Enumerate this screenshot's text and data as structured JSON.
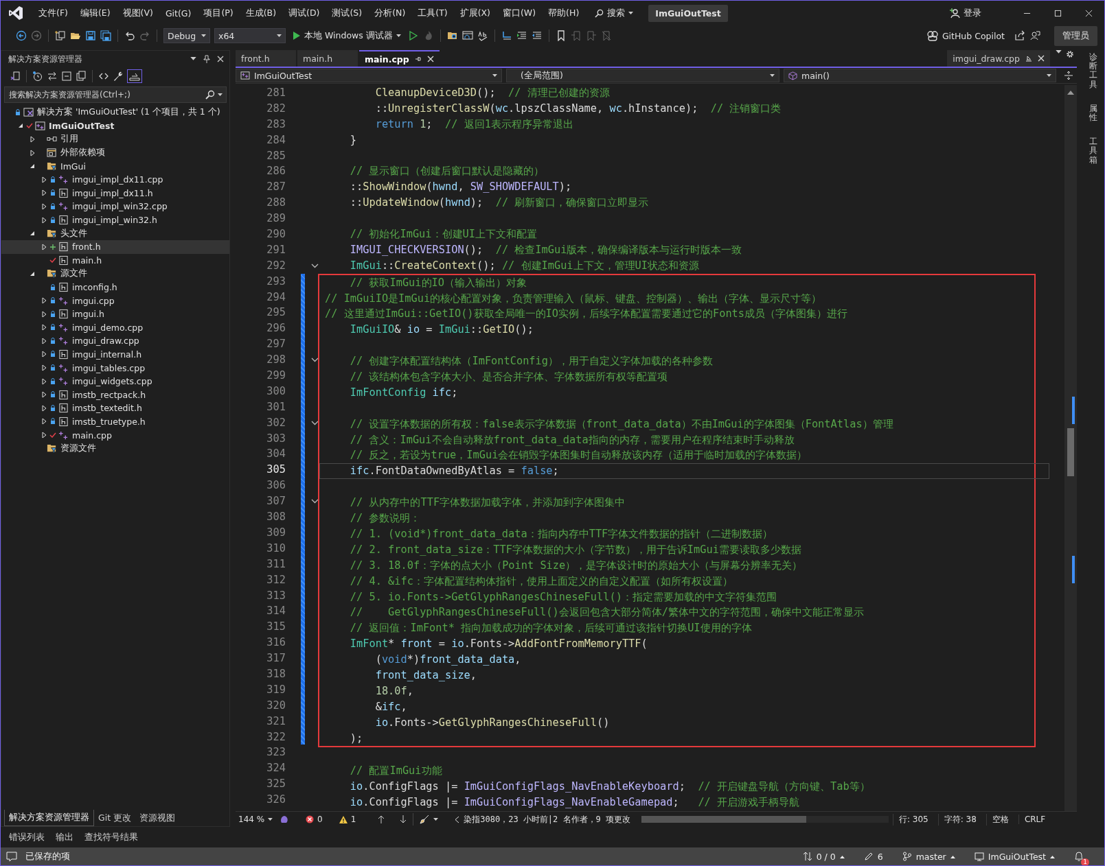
{
  "title_bar": {
    "menus": [
      "文件(F)",
      "编辑(E)",
      "视图(V)",
      "Git(G)",
      "项目(P)",
      "生成(B)",
      "调试(D)",
      "测试(S)",
      "分析(N)",
      "工具(T)",
      "扩展(X)",
      "窗口(W)",
      "帮助(H)"
    ],
    "search": "搜索",
    "title": "ImGuiOutTest",
    "sign_in": "登录"
  },
  "toolbar": {
    "configuration": "Debug",
    "platform": "x64",
    "run": "本地 Windows 调试器",
    "copilot": "GitHub Copilot",
    "admin": "管理员"
  },
  "solution_explorer": {
    "title": "解决方案资源管理器",
    "search": {
      "placeholder": "搜索解决方案资源管理器(Ctrl+;)"
    },
    "tree": [
      {
        "label": "解决方案 'ImGuiOutTest' (1 个项目，共 1 个)",
        "kind": "solution",
        "locked": true,
        "selected": false,
        "children": [
          {
            "label": "ImGuiOutTest",
            "kind": "project",
            "modified": true,
            "expanded": true,
            "selected": false,
            "children": [
              {
                "label": "引用",
                "kind": "references",
                "expanded": false,
                "selected": false
              },
              {
                "label": "外部依赖项",
                "kind": "dependencies",
                "expanded": false,
                "selected": false
              },
              {
                "label": "ImGui",
                "kind": "filter",
                "expanded": true,
                "selected": false,
                "children": [
                  {
                    "label": "imgui_impl_dx11.cpp",
                    "kind": "cpp",
                    "locked": true,
                    "expanded": false,
                    "selected": false
                  },
                  {
                    "label": "imgui_impl_dx11.h",
                    "kind": "header",
                    "locked": true,
                    "expanded": false,
                    "selected": false
                  },
                  {
                    "label": "imgui_impl_win32.cpp",
                    "kind": "cpp",
                    "locked": true,
                    "expanded": false,
                    "selected": false
                  },
                  {
                    "label": "imgui_impl_win32.h",
                    "kind": "header",
                    "locked": true,
                    "expanded": false,
                    "selected": false
                  }
                ]
              },
              {
                "label": "头文件",
                "kind": "filter",
                "expanded": true,
                "selected": false,
                "children": [
                  {
                    "label": "front.h",
                    "kind": "header",
                    "added": true,
                    "expanded": false,
                    "selected": true
                  },
                  {
                    "label": "main.h",
                    "kind": "header",
                    "modified": true,
                    "selected": false
                  }
                ]
              },
              {
                "label": "源文件",
                "kind": "filter",
                "expanded": true,
                "selected": false,
                "children": [
                  {
                    "label": "imconfig.h",
                    "kind": "header",
                    "locked": true,
                    "selected": false
                  },
                  {
                    "label": "imgui.cpp",
                    "kind": "cpp",
                    "locked": true,
                    "expanded": false,
                    "selected": false
                  },
                  {
                    "label": "imgui.h",
                    "kind": "header",
                    "locked": true,
                    "expanded": false,
                    "selected": false
                  },
                  {
                    "label": "imgui_demo.cpp",
                    "kind": "cpp",
                    "locked": true,
                    "expanded": false,
                    "selected": false
                  },
                  {
                    "label": "imgui_draw.cpp",
                    "kind": "cpp",
                    "locked": true,
                    "expanded": false,
                    "selected": false
                  },
                  {
                    "label": "imgui_internal.h",
                    "kind": "header",
                    "locked": true,
                    "expanded": false,
                    "selected": false
                  },
                  {
                    "label": "imgui_tables.cpp",
                    "kind": "cpp",
                    "locked": true,
                    "expanded": false,
                    "selected": false
                  },
                  {
                    "label": "imgui_widgets.cpp",
                    "kind": "cpp",
                    "locked": true,
                    "expanded": false,
                    "selected": false
                  },
                  {
                    "label": "imstb_rectpack.h",
                    "kind": "header",
                    "locked": true,
                    "expanded": false,
                    "selected": false
                  },
                  {
                    "label": "imstb_textedit.h",
                    "kind": "header",
                    "locked": true,
                    "expanded": false,
                    "selected": false
                  },
                  {
                    "label": "imstb_truetype.h",
                    "kind": "header",
                    "locked": true,
                    "expanded": false,
                    "selected": false
                  },
                  {
                    "label": "main.cpp",
                    "kind": "cpp",
                    "modified": true,
                    "expanded": false,
                    "selected": false
                  }
                ]
              },
              {
                "label": "资源文件",
                "kind": "filter",
                "selected": false
              }
            ]
          }
        ]
      }
    ]
  },
  "panel_tabs": [
    {
      "label": "解决方案资源管理器",
      "selected": true
    },
    {
      "label": "Git 更改",
      "selected": false
    },
    {
      "label": "资源视图",
      "selected": false
    }
  ],
  "tool_tabs": [
    "错误列表",
    "输出",
    "查找符号结果"
  ],
  "editor": {
    "tabs": [
      {
        "label": "front.h",
        "selected": false
      },
      {
        "label": "main.h",
        "selected": false
      },
      {
        "label": "main.cpp",
        "selected": true
      }
    ],
    "preview_tab": "imgui_draw.cpp",
    "nav": {
      "project": "ImGuiOutTest",
      "scope": "(全局范围)",
      "member": "main()"
    },
    "sections": [
      {
        "lines": [
          {
            "number": "281",
            "tokens": [
              {
                "text": "        CleanupDeviceD3D",
                "kind": "function"
              },
              {
                "text": "();  ",
                "kind": "plain"
              },
              {
                "text": "// 清理已创建的资源",
                "kind": "comment"
              }
            ]
          },
          {
            "number": "282",
            "tokens": [
              {
                "text": "        ::",
                "kind": "plain"
              },
              {
                "text": "UnregisterClassW",
                "kind": "function"
              },
              {
                "text": "(",
                "kind": "plain"
              },
              {
                "text": "wc",
                "kind": "variable"
              },
              {
                "text": ".lpszClassName, ",
                "kind": "plain"
              },
              {
                "text": "wc",
                "kind": "variable"
              },
              {
                "text": ".hInstance);  ",
                "kind": "plain"
              },
              {
                "text": "// 注销窗口类",
                "kind": "comment"
              }
            ]
          },
          {
            "number": "283",
            "tokens": [
              {
                "text": "        return",
                "kind": "keyword"
              },
              {
                "text": " 1",
                "kind": "number"
              },
              {
                "text": ";  ",
                "kind": "plain"
              },
              {
                "text": "// 返回1表示程序异常退出",
                "kind": "comment"
              }
            ]
          },
          {
            "number": "284",
            "tokens": [
              {
                "text": "    }",
                "kind": "plain"
              }
            ]
          },
          {
            "number": "285"
          },
          {
            "number": "286",
            "tokens": [
              {
                "text": "    // 显示窗口（创建后窗口默认是隐藏的）",
                "kind": "comment"
              }
            ]
          },
          {
            "number": "287",
            "tokens": [
              {
                "text": "    ::",
                "kind": "plain"
              },
              {
                "text": "ShowWindow",
                "kind": "function"
              },
              {
                "text": "(",
                "kind": "plain"
              },
              {
                "text": "hwnd",
                "kind": "variable"
              },
              {
                "text": ", ",
                "kind": "plain"
              },
              {
                "text": "SW_SHOWDEFAULT",
                "kind": "macro"
              },
              {
                "text": ");",
                "kind": "plain"
              }
            ]
          },
          {
            "number": "288",
            "tokens": [
              {
                "text": "    ::",
                "kind": "plain"
              },
              {
                "text": "UpdateWindow",
                "kind": "function"
              },
              {
                "text": "(",
                "kind": "plain"
              },
              {
                "text": "hwnd",
                "kind": "variable"
              },
              {
                "text": ");  ",
                "kind": "plain"
              },
              {
                "text": "// 刷新窗口，确保窗口立即显示",
                "kind": "comment"
              }
            ]
          },
          {
            "number": "289"
          },
          {
            "number": "290",
            "tokens": [
              {
                "text": "    // 初始化ImGui：创建UI上下文和配置",
                "kind": "comment"
              }
            ]
          },
          {
            "number": "291",
            "tokens": [
              {
                "text": "    IMGUI_CHECKVERSION",
                "kind": "macro"
              },
              {
                "text": "();  ",
                "kind": "plain"
              },
              {
                "text": "// 检查ImGui版本，确保编译版本与运行时版本一致",
                "kind": "comment"
              }
            ]
          },
          {
            "number": "292",
            "fold": true,
            "tokens": [
              {
                "text": "    ImGui",
                "kind": "type"
              },
              {
                "text": "::",
                "kind": "plain"
              },
              {
                "text": "CreateContext",
                "kind": "function"
              },
              {
                "text": "(); ",
                "kind": "plain"
              },
              {
                "text": "// 创建ImGui上下文，管理UI状态和资源",
                "kind": "comment"
              }
            ]
          }
        ]
      },
      {
        "changed": true,
        "boxed": true,
        "lines": [
          {
            "number": "293",
            "tokens": [
              {
                "text": "    // 获取ImGui的IO（输入输出）对象",
                "kind": "comment"
              }
            ]
          },
          {
            "number": "294",
            "tokens": [
              {
                "text": "// ImGuiIO是ImGui的核心配置对象，负责管理输入（鼠标、键盘、控制器）、输出（字体、显示尺寸等）",
                "kind": "comment"
              }
            ]
          },
          {
            "number": "295",
            "tokens": [
              {
                "text": "// 这里通过ImGui::GetIO()获取全局唯一的IO实例，后续字体配置需要通过它的Fonts成员（字体图集）进行",
                "kind": "comment"
              }
            ]
          },
          {
            "number": "296",
            "tokens": [
              {
                "text": "    ImGuiIO",
                "kind": "type"
              },
              {
                "text": "& ",
                "kind": "plain"
              },
              {
                "text": "io",
                "kind": "variable"
              },
              {
                "text": " = ",
                "kind": "plain"
              },
              {
                "text": "ImGui",
                "kind": "type"
              },
              {
                "text": "::",
                "kind": "plain"
              },
              {
                "text": "GetIO",
                "kind": "function"
              },
              {
                "text": "();",
                "kind": "plain"
              }
            ]
          },
          {
            "number": "297"
          },
          {
            "number": "298",
            "fold": true,
            "tokens": [
              {
                "text": "    // 创建字体配置结构体（ImFontConfig），用于自定义字体加载的各种参数",
                "kind": "comment"
              }
            ]
          },
          {
            "number": "299",
            "tokens": [
              {
                "text": "    // 该结构体包含字体大小、是否合并字体、字体数据所有权等配置项",
                "kind": "comment"
              }
            ]
          },
          {
            "number": "300",
            "tokens": [
              {
                "text": "    ImFontConfig",
                "kind": "type"
              },
              {
                "text": " ifc",
                "kind": "variable"
              },
              {
                "text": ";",
                "kind": "plain"
              }
            ]
          },
          {
            "number": "301"
          },
          {
            "number": "302",
            "fold": true,
            "tokens": [
              {
                "text": "    // 设置字体数据的所有权：false表示字体数据（front_data_data）不由ImGui的字体图集（FontAtlas）管理",
                "kind": "comment"
              }
            ]
          },
          {
            "number": "303",
            "tokens": [
              {
                "text": "    // 含义：ImGui不会自动释放front_data_data指向的内存，需要用户在程序结束时手动释放",
                "kind": "comment"
              }
            ]
          },
          {
            "number": "304",
            "tokens": [
              {
                "text": "    // 反之，若设为true，ImGui会在销毁字体图集时自动释放该内存（适用于临时加载的字体数据）",
                "kind": "comment"
              }
            ]
          },
          {
            "number": "305",
            "current": true,
            "tokens": [
              {
                "text": "    ifc",
                "kind": "variable"
              },
              {
                "text": ".FontDataOwnedByAtlas = ",
                "kind": "plain"
              },
              {
                "text": "false",
                "kind": "keyword"
              },
              {
                "text": ";",
                "kind": "plain"
              }
            ]
          },
          {
            "number": "306"
          },
          {
            "number": "307",
            "fold": true,
            "tokens": [
              {
                "text": "    // 从内存中的TTF字体数据加载字体，并添加到字体图集中",
                "kind": "comment"
              }
            ]
          },
          {
            "number": "308",
            "tokens": [
              {
                "text": "    // 参数说明：",
                "kind": "comment"
              }
            ]
          },
          {
            "number": "309",
            "tokens": [
              {
                "text": "    // 1. (void*)front_data_data：指向内存中TTF字体文件数据的指针（二进制数据）",
                "kind": "comment"
              }
            ]
          },
          {
            "number": "310",
            "tokens": [
              {
                "text": "    // 2. front_data_size：TTF字体数据的大小（字节数），用于告诉ImGui需要读取多少数据",
                "kind": "comment"
              }
            ]
          },
          {
            "number": "311",
            "tokens": [
              {
                "text": "    // 3. 18.0f：字体的点大小（Point Size），是字体设计时的原始大小（与屏幕分辨率无关）",
                "kind": "comment"
              }
            ]
          },
          {
            "number": "312",
            "tokens": [
              {
                "text": "    // 4. &ifc：字体配置结构体指针，使用上面定义的自定义配置（如所有权设置）",
                "kind": "comment"
              }
            ]
          },
          {
            "number": "313",
            "tokens": [
              {
                "text": "    // 5. io.Fonts->GetGlyphRangesChineseFull()：指定需要加载的中文字符集范围",
                "kind": "comment"
              }
            ]
          },
          {
            "number": "314",
            "tokens": [
              {
                "text": "    //    GetGlyphRangesChineseFull()会返回包含大部分简体/繁体中文的字符范围，确保中文能正常显示",
                "kind": "comment"
              }
            ]
          },
          {
            "number": "315",
            "tokens": [
              {
                "text": "    // 返回值：ImFont* 指向加载成功的字体对象，后续可通过该指针切换UI使用的字体",
                "kind": "comment"
              }
            ]
          },
          {
            "number": "316",
            "tokens": [
              {
                "text": "    ImFont",
                "kind": "type"
              },
              {
                "text": "* ",
                "kind": "plain"
              },
              {
                "text": "front",
                "kind": "variable"
              },
              {
                "text": " = ",
                "kind": "plain"
              },
              {
                "text": "io",
                "kind": "variable"
              },
              {
                "text": ".Fonts->",
                "kind": "plain"
              },
              {
                "text": "AddFontFromMemoryTTF",
                "kind": "function"
              },
              {
                "text": "(",
                "kind": "plain"
              }
            ]
          },
          {
            "number": "317",
            "tokens": [
              {
                "text": "        (",
                "kind": "plain"
              },
              {
                "text": "void",
                "kind": "keyword"
              },
              {
                "text": "*)",
                "kind": "plain"
              },
              {
                "text": "front_data_data",
                "kind": "variable"
              },
              {
                "text": ",",
                "kind": "plain"
              }
            ]
          },
          {
            "number": "318",
            "tokens": [
              {
                "text": "        front_data_size",
                "kind": "variable"
              },
              {
                "text": ",",
                "kind": "plain"
              }
            ]
          },
          {
            "number": "319",
            "tokens": [
              {
                "text": "        18.0f",
                "kind": "number"
              },
              {
                "text": ",",
                "kind": "plain"
              }
            ]
          },
          {
            "number": "320",
            "tokens": [
              {
                "text": "        &",
                "kind": "plain"
              },
              {
                "text": "ifc",
                "kind": "variable"
              },
              {
                "text": ",",
                "kind": "plain"
              }
            ]
          },
          {
            "number": "321",
            "tokens": [
              {
                "text": "        io",
                "kind": "variable"
              },
              {
                "text": ".Fonts->",
                "kind": "plain"
              },
              {
                "text": "GetGlyphRangesChineseFull",
                "kind": "function"
              },
              {
                "text": "()",
                "kind": "plain"
              }
            ]
          },
          {
            "number": "322",
            "tokens": [
              {
                "text": "    );",
                "kind": "plain"
              }
            ]
          }
        ]
      },
      {
        "lines": [
          {
            "number": "323"
          },
          {
            "number": "324",
            "tokens": [
              {
                "text": "    // 配置ImGui功能",
                "kind": "comment"
              }
            ]
          },
          {
            "number": "325",
            "tokens": [
              {
                "text": "    io",
                "kind": "variable"
              },
              {
                "text": ".ConfigFlags |= ",
                "kind": "plain"
              },
              {
                "text": "ImGuiConfigFlags_NavEnableKeyboard",
                "kind": "macro"
              },
              {
                "text": ";  ",
                "kind": "plain"
              },
              {
                "text": "// 开启键盘导航（方向键、Tab等）",
                "kind": "comment"
              }
            ]
          },
          {
            "number": "326",
            "tokens": [
              {
                "text": "    io",
                "kind": "variable"
              },
              {
                "text": ".ConfigFlags |= ",
                "kind": "plain"
              },
              {
                "text": "ImGuiConfigFlags_NavEnableGamepad",
                "kind": "macro"
              },
              {
                "text": ";   ",
                "kind": "plain"
              },
              {
                "text": "// 开启游戏手柄导航",
                "kind": "comment"
              }
            ]
          }
        ]
      }
    ],
    "status": {
      "zoom": "144 %",
      "errors": "0",
      "warnings": "1",
      "blame": "染指3080，23 小时前|2 名作者，9 项更改",
      "line": "行: 305",
      "char": "字符: 38",
      "indent": "空格",
      "eol": "CRLF"
    }
  },
  "side_strip": [
    "诊断工具",
    "属性",
    "工具箱"
  ],
  "status_bar": {
    "message": "已保存的项",
    "sync": "0 / 0",
    "edits": "6",
    "branch": "master",
    "repo": "ImGuiOutTest",
    "notifications": "1"
  }
}
